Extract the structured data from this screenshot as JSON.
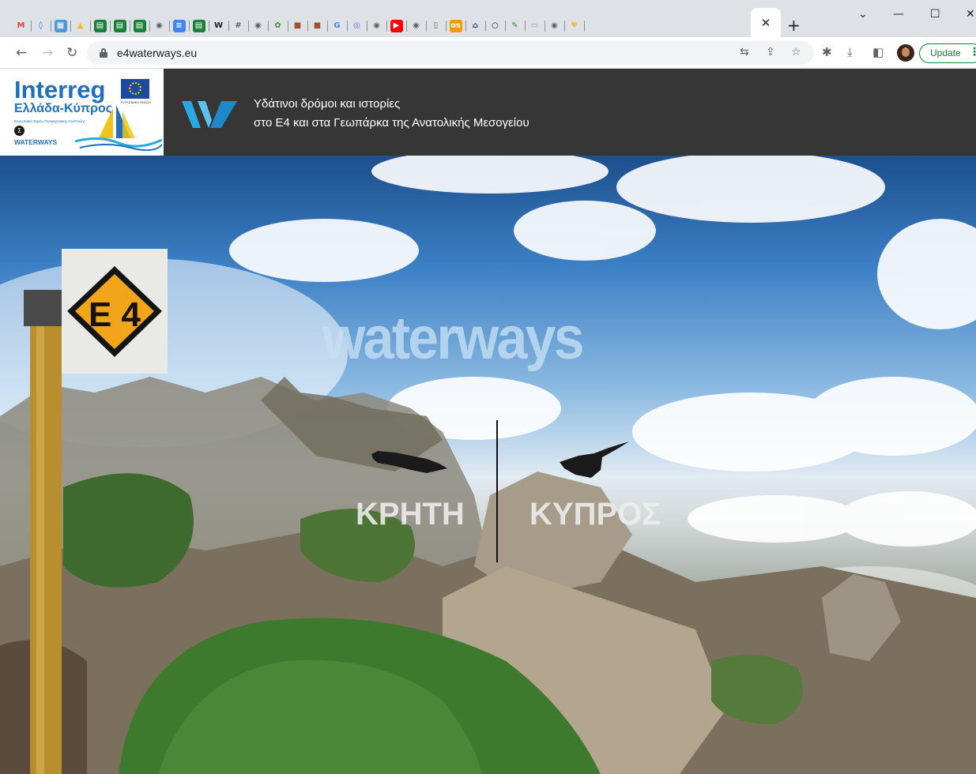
{
  "browser": {
    "tabs": [
      {
        "icon": "gmail-icon",
        "glyph": "M",
        "color": "#ea4335",
        "bg": "transparent"
      },
      {
        "icon": "drop-icon",
        "glyph": "◊",
        "color": "#1a73e8",
        "bg": "transparent"
      },
      {
        "icon": "photo-icon",
        "glyph": "▦",
        "color": "#fff",
        "bg": "#4e9ad6"
      },
      {
        "icon": "drive-icon",
        "glyph": "▲",
        "color": "#fbbc04",
        "bg": "transparent"
      },
      {
        "icon": "sheets-icon",
        "glyph": "▤",
        "color": "#fff",
        "bg": "#188038"
      },
      {
        "icon": "sheets-icon",
        "glyph": "▤",
        "color": "#fff",
        "bg": "#188038"
      },
      {
        "icon": "sheets-icon",
        "glyph": "▤",
        "color": "#fff",
        "bg": "#188038"
      },
      {
        "icon": "globe-icon",
        "glyph": "◉",
        "color": "#5f6368",
        "bg": "transparent"
      },
      {
        "icon": "docs-icon",
        "glyph": "≡",
        "color": "#fff",
        "bg": "#4285f4"
      },
      {
        "icon": "sheets-icon",
        "glyph": "▤",
        "color": "#fff",
        "bg": "#188038"
      },
      {
        "icon": "wiki-icon",
        "glyph": "W",
        "color": "#202124",
        "bg": "transparent"
      },
      {
        "icon": "grid-icon",
        "glyph": "#",
        "color": "#5f6368",
        "bg": "transparent"
      },
      {
        "icon": "globe-icon",
        "glyph": "◉",
        "color": "#5f6368",
        "bg": "transparent"
      },
      {
        "icon": "emblem-icon",
        "glyph": "✿",
        "color": "#3a8a3a",
        "bg": "transparent"
      },
      {
        "icon": "bag-icon",
        "glyph": "■",
        "color": "#a0522d",
        "bg": "transparent"
      },
      {
        "icon": "bag-icon",
        "glyph": "■",
        "color": "#a0522d",
        "bg": "transparent"
      },
      {
        "icon": "google-icon",
        "glyph": "G",
        "color": "#4285f4",
        "bg": "transparent"
      },
      {
        "icon": "viber-icon",
        "glyph": "◎",
        "color": "#7360f2",
        "bg": "transparent"
      },
      {
        "icon": "globe-icon",
        "glyph": "◉",
        "color": "#5f6368",
        "bg": "transparent"
      },
      {
        "icon": "youtube-icon",
        "glyph": "▶",
        "color": "#fff",
        "bg": "#ff0000"
      },
      {
        "icon": "globe-icon",
        "glyph": "◉",
        "color": "#5f6368",
        "bg": "transparent"
      },
      {
        "icon": "document-icon",
        "glyph": "▯",
        "color": "#5f6368",
        "bg": "transparent"
      },
      {
        "icon": "os-icon",
        "glyph": "os",
        "color": "#fff",
        "bg": "#f29900"
      },
      {
        "icon": "museum-icon",
        "glyph": "⌂",
        "color": "#1a3e8a",
        "bg": "transparent"
      },
      {
        "icon": "circle-icon",
        "glyph": "○",
        "color": "#202124",
        "bg": "transparent"
      },
      {
        "icon": "map-icon",
        "glyph": "✎",
        "color": "#3a8a3a",
        "bg": "transparent"
      },
      {
        "icon": "page-icon",
        "glyph": "▭",
        "color": "#9aa0a6",
        "bg": "transparent"
      },
      {
        "icon": "globe-icon",
        "glyph": "◉",
        "color": "#5f6368",
        "bg": "transparent"
      },
      {
        "icon": "shield-icon",
        "glyph": "♥",
        "color": "#f0c040",
        "bg": "transparent"
      }
    ],
    "url": "e4waterways.eu",
    "update_label": "Update"
  },
  "header": {
    "logo_title": "Interreg",
    "logo_subtitle": "Ελλάδα-Κύπρος",
    "logo_fund_text": "Ευρωπαϊκό Ταμείο Περιφερειακής Ανάπτυξης",
    "logo_eu_caption": "ΕΥΡΩΠΑΪΚΗ ΕΝΩΣΗ",
    "logo_sigma": "Σ",
    "logo_project": "WATERWAYS",
    "tagline_1": "Υδάτινοι δρόμοι και ιστορίες",
    "tagline_2": "στο Ε4 και στα Γεωπάρκα της Ανατολικής Μεσογείου"
  },
  "hero": {
    "sign_label": "E 4",
    "title": "waterways",
    "links": [
      "ΚΡΗΤΗ",
      "ΚΥΠΡΟΣ"
    ]
  }
}
